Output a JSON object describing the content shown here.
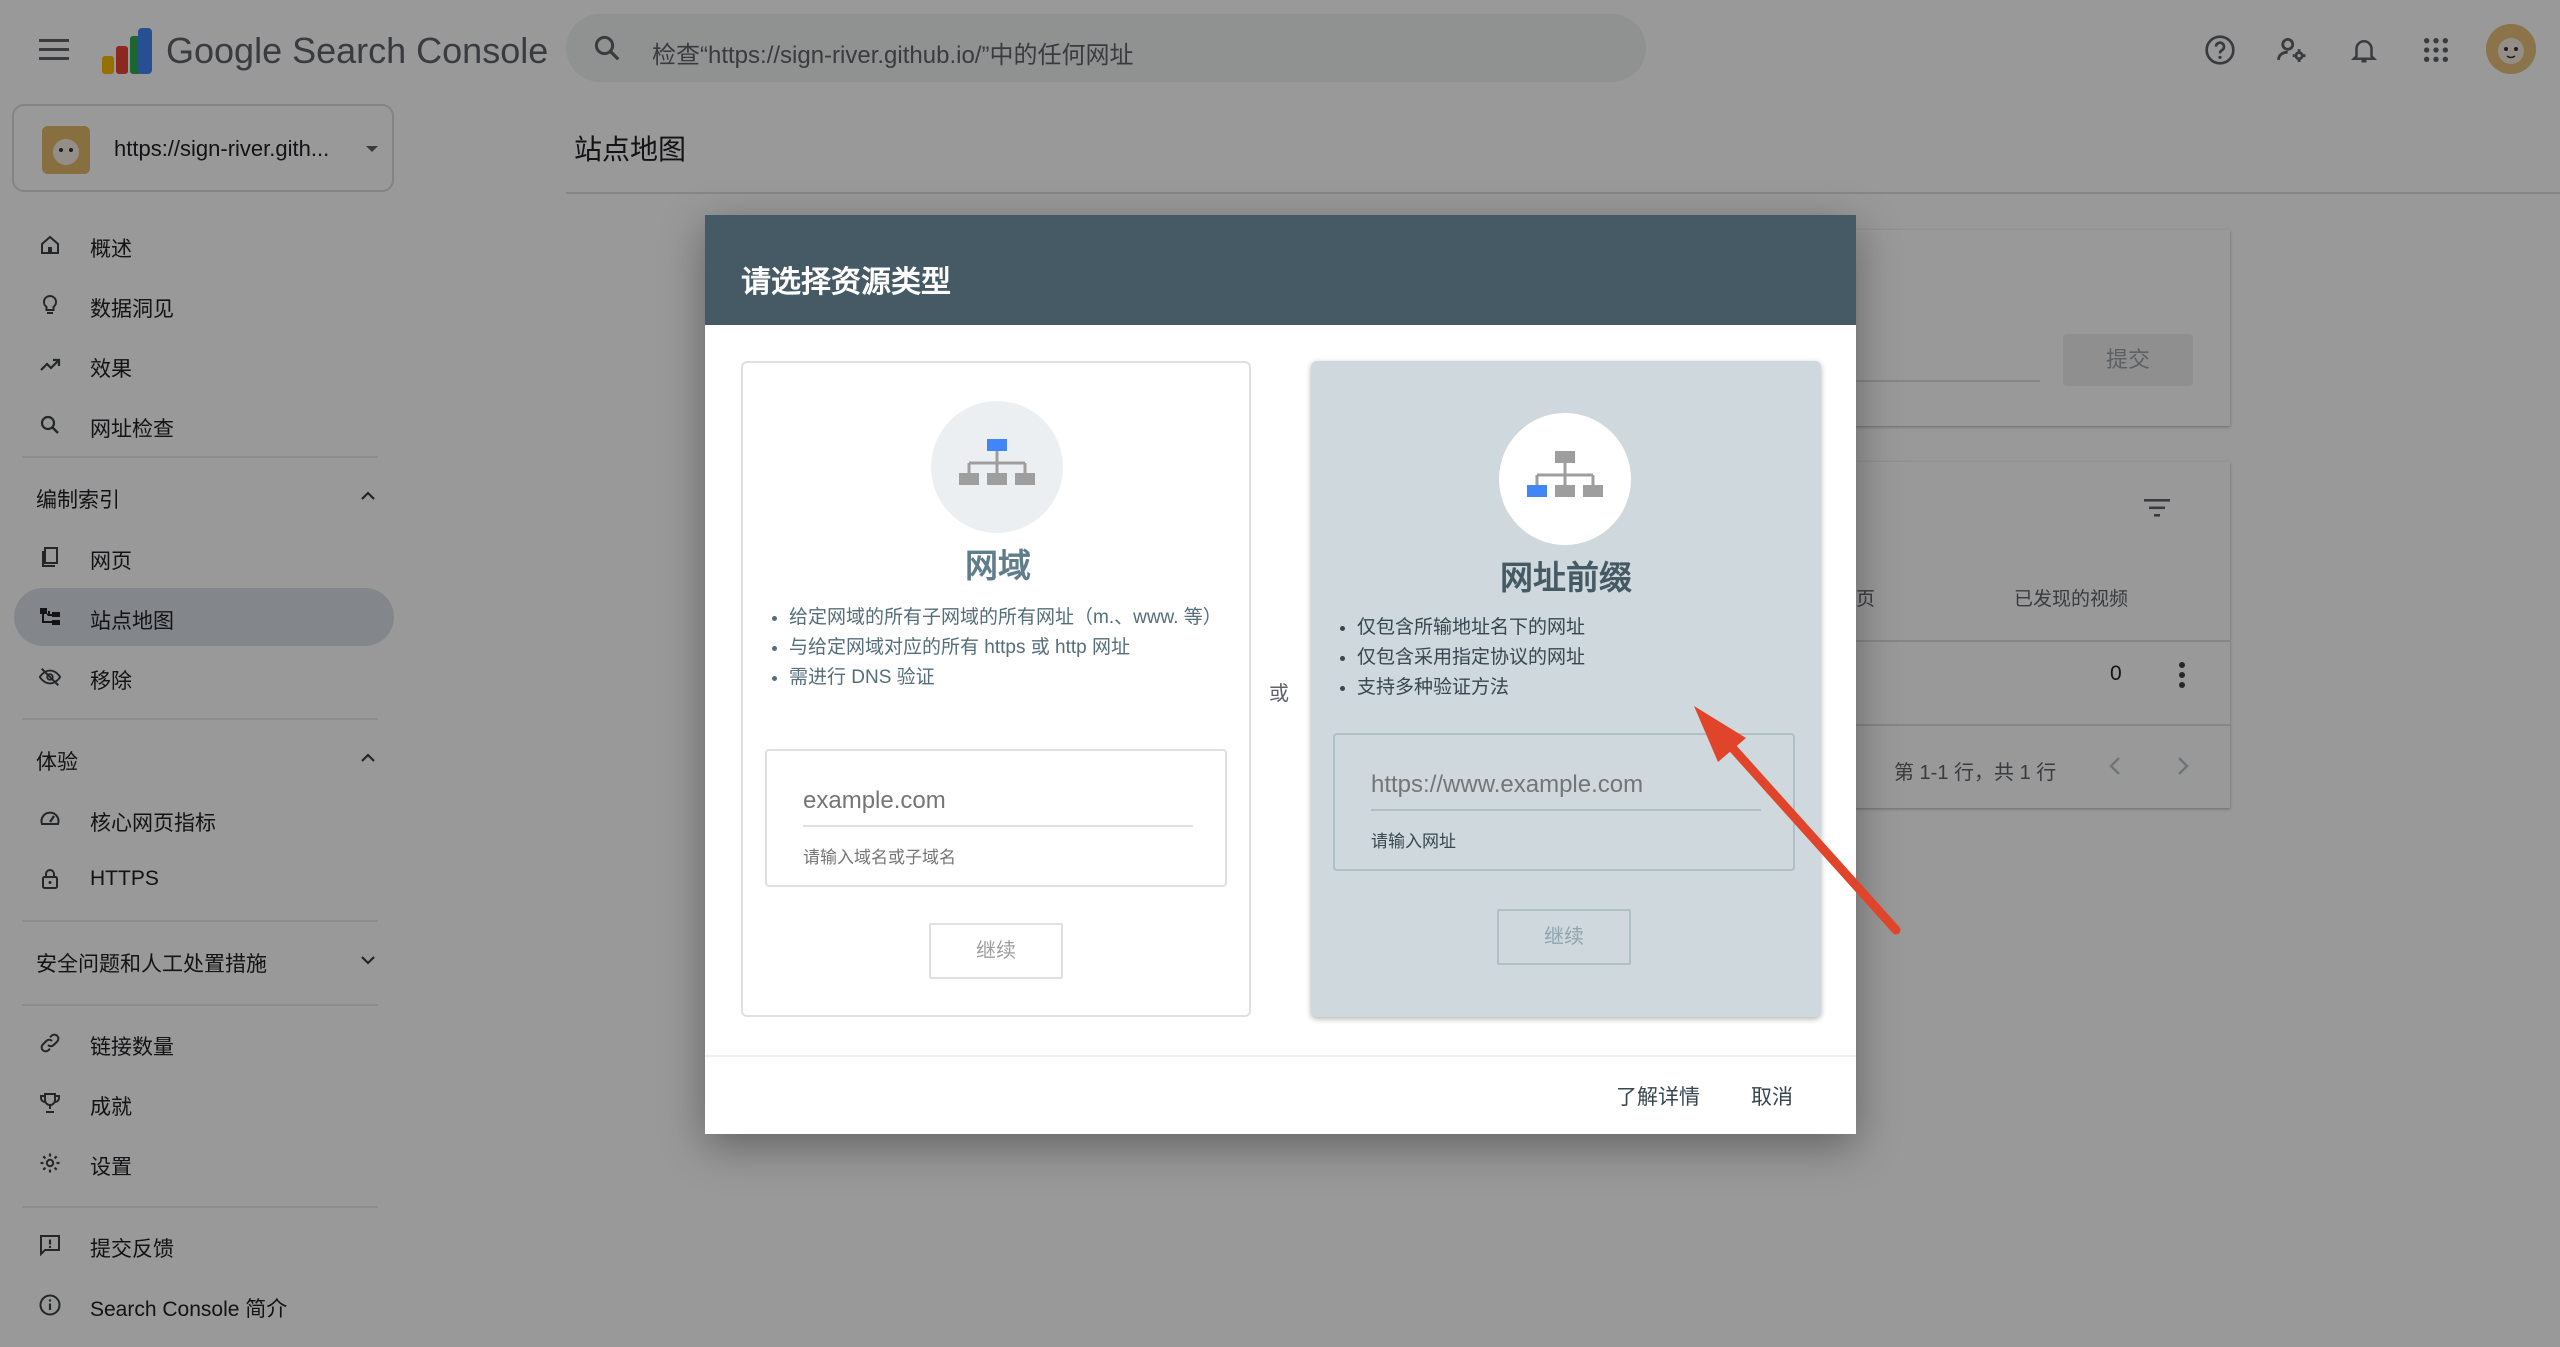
{
  "header": {
    "brand": "Google Search Console",
    "search_placeholder": "检查“https://sign-river.github.io/”中的任何网址",
    "icons": [
      "menu-icon",
      "help-icon",
      "manage-users-icon",
      "notifications-icon",
      "apps-icon",
      "account-avatar"
    ]
  },
  "sidebar": {
    "property": "https://sign-river.gith...",
    "items": [
      {
        "label": "概述",
        "icon": "home-icon"
      },
      {
        "label": "数据洞见",
        "icon": "lightbulb-icon"
      },
      {
        "label": "效果",
        "icon": "trending-up-icon"
      },
      {
        "label": "网址检查",
        "icon": "search-icon"
      }
    ],
    "section_index": {
      "title": "编制索引",
      "items": [
        {
          "label": "网页",
          "icon": "pages-icon"
        },
        {
          "label": "站点地图",
          "icon": "sitemap-icon",
          "active": true
        },
        {
          "label": "移除",
          "icon": "visibility-off-icon"
        }
      ]
    },
    "section_experience": {
      "title": "体验",
      "items": [
        {
          "label": "核心网页指标",
          "icon": "speed-icon"
        },
        {
          "label": "HTTPS",
          "icon": "lock-icon"
        }
      ]
    },
    "section_security": {
      "title": "安全问题和人工处置措施"
    },
    "bottom_items": [
      {
        "label": "链接数量",
        "icon": "link-icon"
      },
      {
        "label": "成就",
        "icon": "trophy-icon"
      },
      {
        "label": "设置",
        "icon": "gear-icon"
      }
    ],
    "footer_items": [
      {
        "label": "提交反馈",
        "icon": "feedback-icon"
      },
      {
        "label": "Search Console 简介",
        "icon": "info-icon"
      }
    ]
  },
  "main": {
    "title": "站点地图",
    "submit_label": "提交",
    "table": {
      "columns": [
        "发现的网页",
        "已发现的视频"
      ],
      "row": [
        "0",
        "0"
      ],
      "pager": "第 1-1 行，共 1 行"
    }
  },
  "dialog": {
    "title": "请选择资源类型",
    "or_label": "或",
    "domain": {
      "title": "网域",
      "bullets": [
        "给定网域的所有子网域的所有网址（m.、www. 等）",
        "与给定网域对应的所有 https 或 http 网址",
        "需进行 DNS 验证"
      ],
      "placeholder": "example.com",
      "hint": "请输入域名或子域名",
      "button": "继续"
    },
    "url_prefix": {
      "title": "网址前缀",
      "bullets": [
        "仅包含所输地址名下的网址",
        "仅包含采用指定协议的网址",
        "支持多种验证方法"
      ],
      "placeholder": "https://www.example.com",
      "hint": "请输入网址",
      "button": "继续"
    },
    "learn_more": "了解详情",
    "cancel": "取消"
  },
  "annotation": {
    "color": "#e0452b",
    "icon": "red-arrow"
  }
}
